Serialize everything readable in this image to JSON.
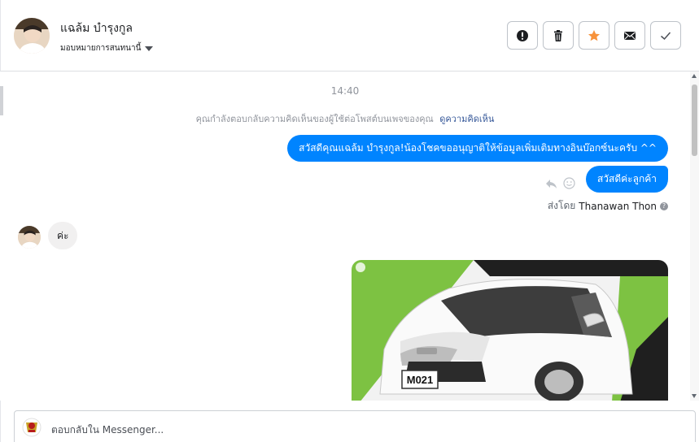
{
  "header": {
    "contact_name": "แฉล้ม บำรุงกูล",
    "assign_label": "มอบหมายการสนทนานี้",
    "actions": [
      {
        "id": "report",
        "icon": "alert-icon"
      },
      {
        "id": "delete",
        "icon": "trash-icon"
      },
      {
        "id": "star",
        "icon": "star-icon"
      },
      {
        "id": "unread",
        "icon": "envelope-icon"
      },
      {
        "id": "done",
        "icon": "check-icon"
      }
    ]
  },
  "thread": {
    "time": "14:40",
    "notice_text": "คุณกำลังตอบกลับความคิดเห็นของผู้ใช้ต่อโพสต์บนเพจของคุณ",
    "notice_link": "ดูความคิดเห็น",
    "outgoing_1": "สวัสดีคุณแฉล้ม บำรุงกูล!น้องโชคขออนุญาติให้ข้อมูลเพิ่มเติมทางอินบ๊อกซ์นะครับ ^^",
    "outgoing_2": "สวัสดีค่ะลูกค้า",
    "sent_by_prefix": "ส่งโดย",
    "sent_by_name": "Thanawan Thon",
    "incoming_1": "ค่ะ",
    "car_plate": "M021"
  },
  "footer": {
    "reply_placeholder": "ตอบกลับใน Messenger..."
  },
  "colors": {
    "accent": "#0084ff",
    "star": "#f7923b",
    "banner_green": "#7dc242"
  }
}
